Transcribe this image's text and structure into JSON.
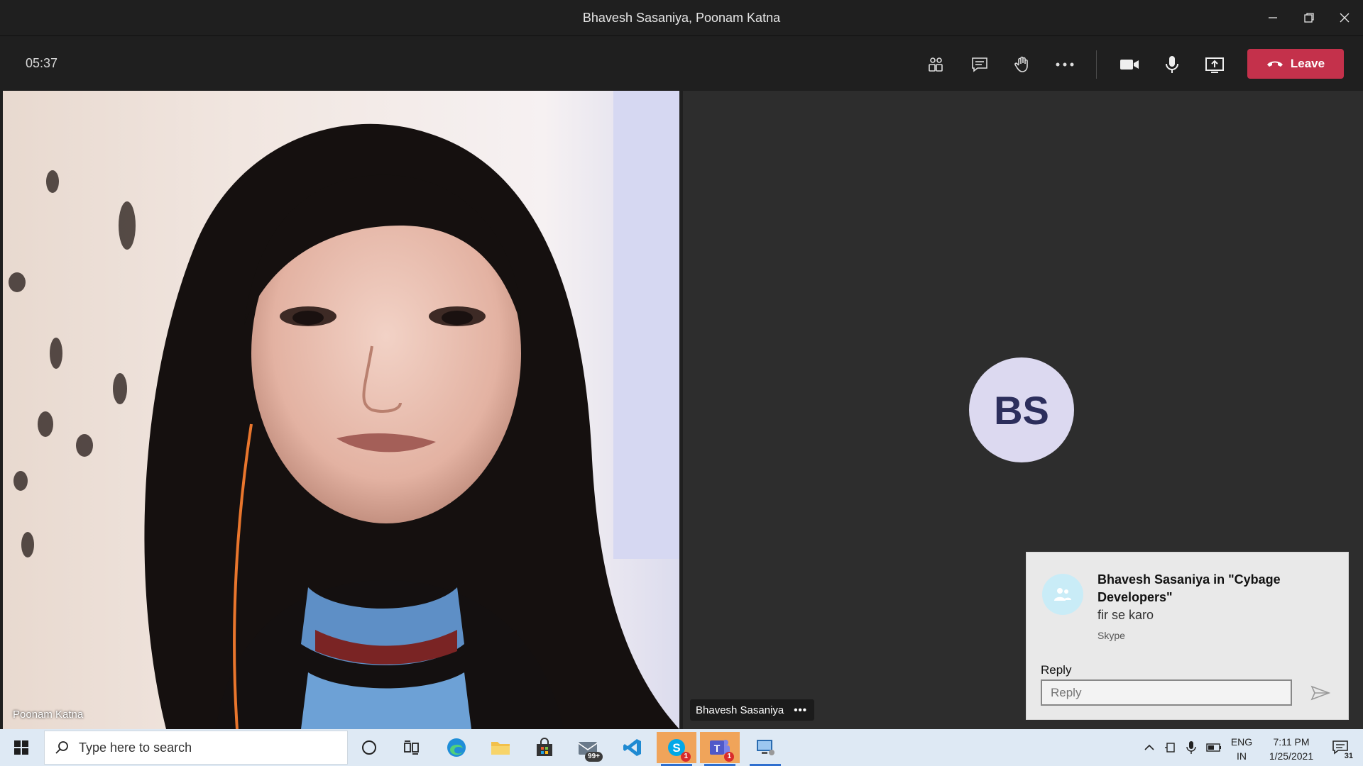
{
  "window": {
    "title": "Bhavesh Sasaniya, Poonam Katna",
    "minimize_icon": "minimize-icon",
    "restore_icon": "restore-icon",
    "close_icon": "close-icon"
  },
  "toolbar": {
    "timer": "05:37",
    "leave_label": "Leave",
    "icons": [
      "people-icon",
      "chat-icon",
      "raise-hand-icon",
      "more-icon",
      "camera-icon",
      "mic-icon",
      "share-icon"
    ]
  },
  "participants": {
    "left": {
      "name": "Poonam Katna"
    },
    "right": {
      "name": "Bhavesh Sasaniya",
      "initials": "BS",
      "more": "•••"
    }
  },
  "toast": {
    "title": "Bhavesh Sasaniya in \"Cybage Developers\"",
    "message": "fir se karo",
    "source": "Skype",
    "reply_label": "Reply",
    "reply_placeholder": "Reply"
  },
  "taskbar": {
    "search_placeholder": "Type here to search",
    "mail_badge": "99+",
    "skype_badge": "1",
    "teams_badge": "1",
    "lang_line1": "ENG",
    "lang_line2": "IN",
    "time": "7:11 PM",
    "date": "1/25/2021",
    "notification_count": "31"
  },
  "colors": {
    "leave": "#c4314b",
    "avatar_bg": "#dcd9f0",
    "avatar_text": "#2c2e5c",
    "taskbar": "#dee9f4"
  }
}
